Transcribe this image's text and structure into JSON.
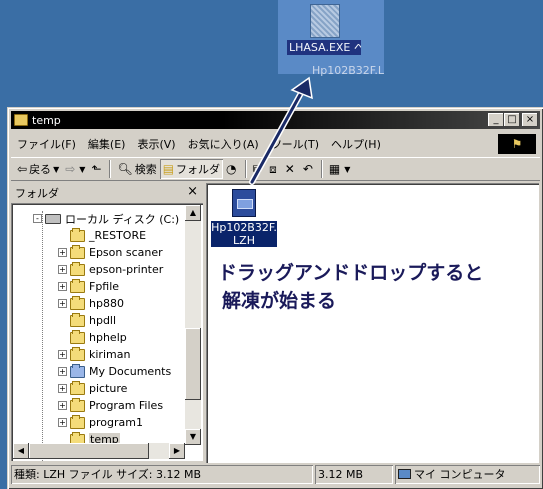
{
  "drag": {
    "label": "LHASA.EXE へのショートカ...",
    "ghost_text": "Hp102B32F.L"
  },
  "window": {
    "title": "temp",
    "buttons": {
      "minimize": "_",
      "maximize": "□",
      "close": "×"
    }
  },
  "menu": {
    "items": [
      "ファイル(F)",
      "編集(E)",
      "表示(V)",
      "お気に入り(A)",
      "ツール(T)",
      "ヘルプ(H)"
    ]
  },
  "toolbar": {
    "back": "戻る",
    "search": "検索",
    "folders": "フォルダ"
  },
  "folder_pane": {
    "title": "フォルダ",
    "close": "×",
    "tree": [
      {
        "label": "ローカル ディスク (C:)",
        "expander": "-",
        "icon": "drive"
      },
      {
        "label": "_RESTORE",
        "expander": "",
        "icon": "folder"
      },
      {
        "label": "Epson scaner",
        "expander": "+",
        "icon": "folder"
      },
      {
        "label": "epson-printer",
        "expander": "+",
        "icon": "folder"
      },
      {
        "label": "Fpfile",
        "expander": "+",
        "icon": "folder"
      },
      {
        "label": "hp880",
        "expander": "+",
        "icon": "folder"
      },
      {
        "label": "hpdll",
        "expander": "",
        "icon": "folder"
      },
      {
        "label": "hphelp",
        "expander": "",
        "icon": "folder"
      },
      {
        "label": "kiriman",
        "expander": "+",
        "icon": "folder"
      },
      {
        "label": "My Documents",
        "expander": "+",
        "icon": "docs"
      },
      {
        "label": "picture",
        "expander": "+",
        "icon": "folder"
      },
      {
        "label": "Program Files",
        "expander": "+",
        "icon": "folder"
      },
      {
        "label": "program1",
        "expander": "+",
        "icon": "folder"
      },
      {
        "label": "temp",
        "expander": "",
        "icon": "folder",
        "selected": true
      }
    ]
  },
  "content": {
    "file_label": "Hp102B32F.LZH",
    "annotation_line1": "ドラッグアンドドロップすると",
    "annotation_line2": "解凍が始まる"
  },
  "status": {
    "info": "種類: LZH ファイル サイズ: 3.12 MB",
    "size": "3.12 MB",
    "location": "マイ コンピュータ"
  },
  "colors": {
    "desktop": "#3a6ea5",
    "title_bar": "#000000",
    "selection": "#0a246a",
    "annotation": "#1a1a5a"
  }
}
